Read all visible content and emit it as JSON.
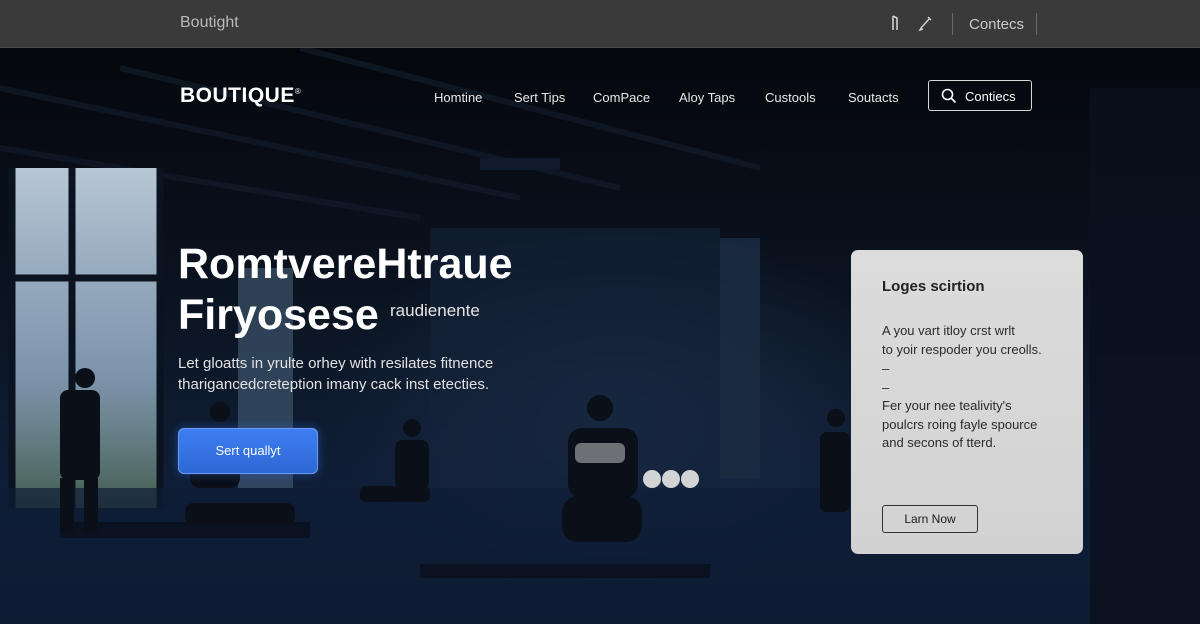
{
  "topbar": {
    "brand": "Boutight",
    "icons": [
      "pin-icon",
      "edit-icon"
    ],
    "link": "Contecs"
  },
  "header": {
    "logo": "BOUTIQUE",
    "logo_mark": "®",
    "nav": [
      "Homtine",
      "Sert Tips",
      "ComPace",
      "Aloy Taps",
      "Custools",
      "Soutacts"
    ],
    "cta_label": "Contiecs",
    "cta_icon": "search-icon"
  },
  "hero": {
    "title_line1": "RomtvereHtraue",
    "title_line2": "Firyosese",
    "title_side": "raudienente",
    "subtitle_line1": "Let gloatts in yrulte orhey with resilates fitnence",
    "subtitle_line2": "tharigancedcreteption imany cack inst etecties.",
    "button_label": "Sert quallyt"
  },
  "card": {
    "title": "Loges scirtion",
    "lines": [
      "A you vart itloy crst wrlt",
      "to yoir respoder you creolls.",
      "–",
      "–",
      "Fer your nee tealivity's",
      "poulcrs roing fayle spource",
      "and secons of tterd."
    ],
    "button_label": "Larn Now"
  },
  "colors": {
    "accent_blue": "#2d67d6",
    "topbar": "#3a3a3a",
    "card": "#d6d6d6"
  }
}
